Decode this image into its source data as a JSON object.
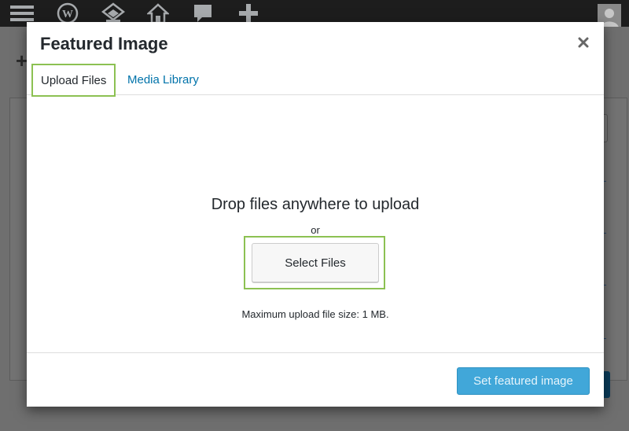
{
  "admin_bar": {
    "icons": [
      "menu-icon",
      "wordpress-logo-icon",
      "site-icon",
      "home-icon",
      "comments-icon",
      "new-content-icon"
    ]
  },
  "modal": {
    "title": "Featured Image",
    "close_icon": "close-icon",
    "tabs": [
      {
        "label": "Upload Files",
        "active": true
      },
      {
        "label": "Media Library",
        "active": false
      }
    ],
    "upload": {
      "drop_text": "Drop files anywhere to upload",
      "or_text": "or",
      "select_button": "Select Files",
      "max_size": "Maximum upload file size: 1 MB."
    },
    "toolbar": {
      "set_button": "Set featured image"
    }
  },
  "colors": {
    "admin_bar": "#1d1d1d",
    "link": "#0073aa",
    "highlight_outline": "#8cc152",
    "primary_button": "#41a7d9"
  }
}
